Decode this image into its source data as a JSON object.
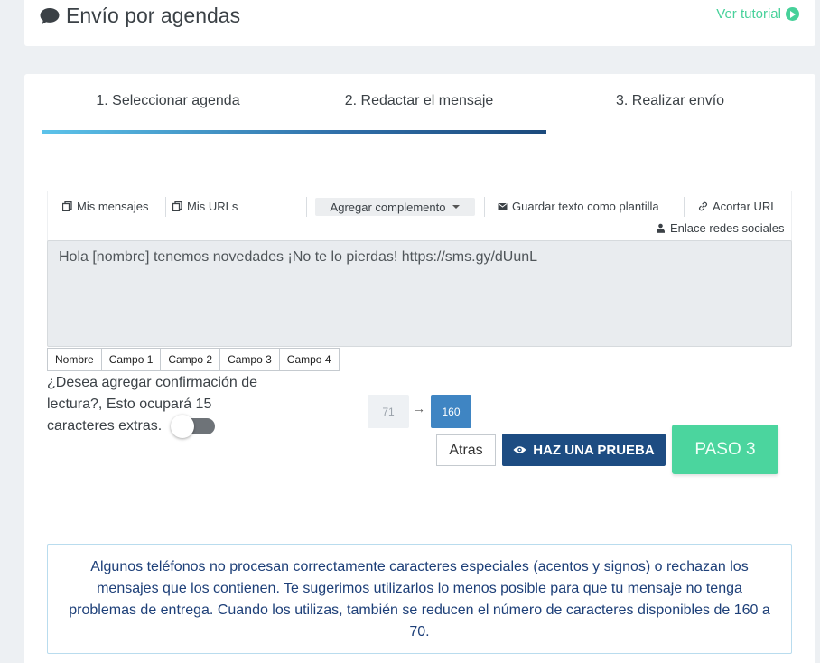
{
  "header": {
    "title": "Envío por agendas",
    "tutorial_label": "Ver tutorial"
  },
  "steps": [
    {
      "label": "1. Seleccionar agenda"
    },
    {
      "label": "2. Redactar el mensaje"
    },
    {
      "label": "3. Realizar envío"
    }
  ],
  "progress": {
    "completed_fraction": 0.667
  },
  "toolbar": {
    "my_messages": "Mis mensajes",
    "my_urls": "Mis URLs",
    "add_plugin": "Agregar complemento",
    "save_template": "Guardar texto como plantilla",
    "shorten_url": "Acortar URL",
    "social_link": "Enlace redes sociales"
  },
  "message": {
    "value": "Hola [nombre] tenemos novedades ¡No te lo pierdas! https://sms.gy/dUunL"
  },
  "fields": [
    "Nombre",
    "Campo 1",
    "Campo 2",
    "Campo 3",
    "Campo 4"
  ],
  "confirmation": {
    "text": "¿Desea agregar confirmación de lectura?, Esto ocupará 15 caracteres extras.",
    "enabled": false
  },
  "counter": {
    "from": "71",
    "to": "160"
  },
  "actions": {
    "back": "Atras",
    "test": "HAZ UNA PRUEBA",
    "next": "PASO 3"
  },
  "notice": {
    "text": "Algunos teléfonos no procesan correctamente caracteres especiales (acentos y signos) o rechazan los mensajes que los contienen. Te sugerimos utilizarlos lo menos posible para que tu mensaje no tenga problemas de entrega. Cuando los utilizas, también se reducen el número de caracteres disponibles de 160 a 70."
  },
  "colors": {
    "accent_green": "#47d19a",
    "primary_blue": "#1d4c82",
    "counter_blue": "#3f85c3",
    "notice_text": "#1d3f78"
  }
}
